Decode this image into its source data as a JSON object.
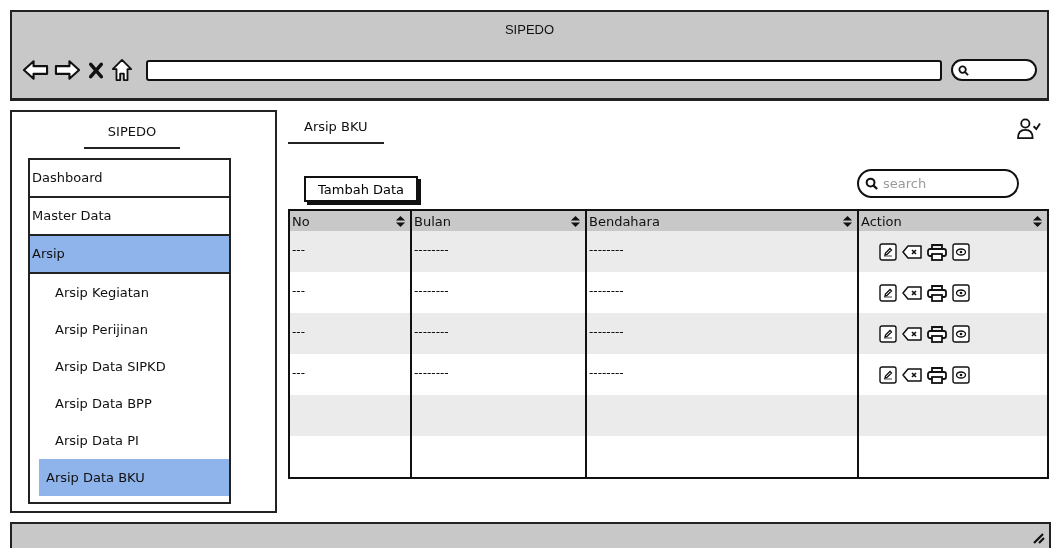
{
  "window": {
    "title": "SIPEDO"
  },
  "sidebar": {
    "title": "SIPEDO",
    "items": [
      {
        "label": "Dashboard",
        "selected": false
      },
      {
        "label": "Master Data",
        "selected": false
      },
      {
        "label": "Arsip",
        "selected": true,
        "children": [
          {
            "label": "Arsip Kegiatan",
            "selected": false
          },
          {
            "label": "Arsip Perijinan",
            "selected": false
          },
          {
            "label": "Arsip Data SIPKD",
            "selected": false
          },
          {
            "label": "Arsip Data BPP",
            "selected": false
          },
          {
            "label": "Arsip Data PI",
            "selected": false
          },
          {
            "label": "Arsip Data BKU",
            "selected": true
          }
        ]
      }
    ]
  },
  "page": {
    "title": "Arsip BKU"
  },
  "toolbar": {
    "add_button": "Tambah Data",
    "search": {
      "placeholder": "search"
    }
  },
  "table": {
    "columns": [
      "No",
      "Bulan",
      "Bendahara",
      "Action"
    ],
    "rows": [
      {
        "cells": [
          "---",
          "--------",
          "--------"
        ]
      },
      {
        "cells": [
          "---",
          "--------",
          "--------"
        ]
      },
      {
        "cells": [
          "---",
          "--------",
          "--------"
        ]
      },
      {
        "cells": [
          "---",
          "--------",
          "--------"
        ]
      }
    ]
  }
}
